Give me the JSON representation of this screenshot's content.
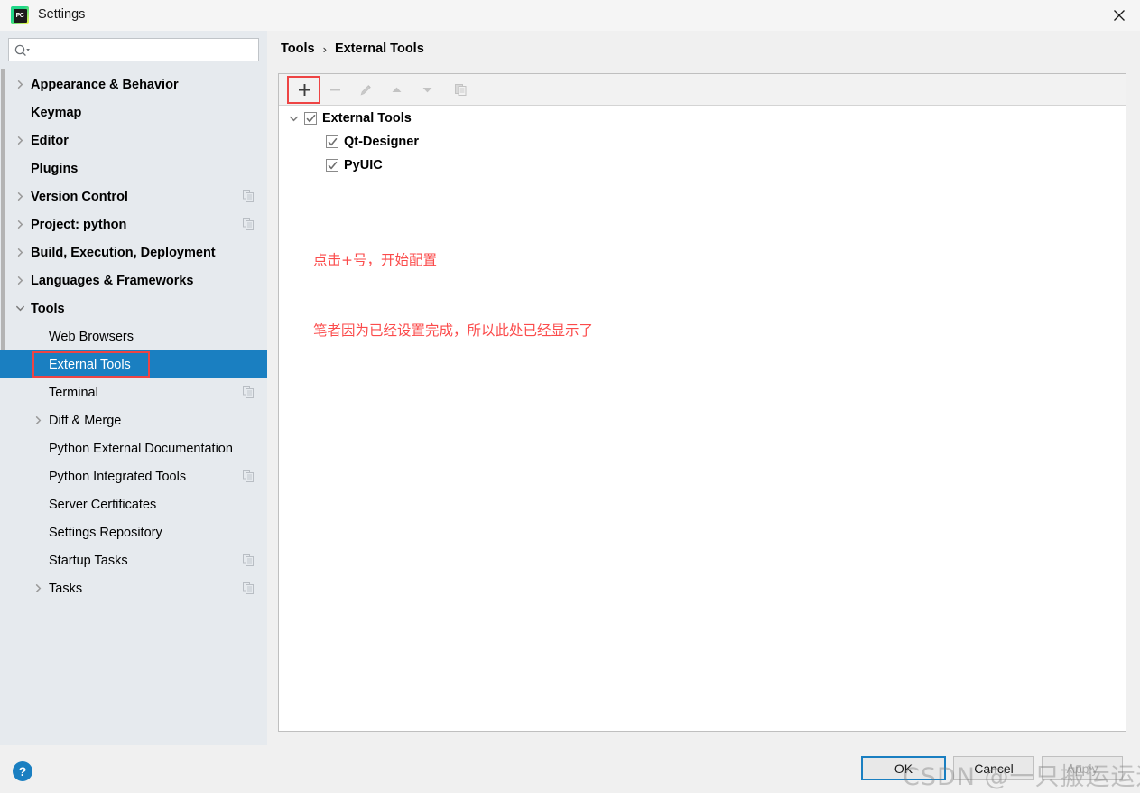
{
  "window": {
    "title": "Settings",
    "logo_text": "PC",
    "close_label": "✕"
  },
  "search": {
    "value": "",
    "placeholder": ""
  },
  "sidebar": {
    "items": [
      {
        "label": "Appearance & Behavior",
        "level": 1,
        "expandable": true,
        "expanded": false,
        "selected": false,
        "badge": false
      },
      {
        "label": "Keymap",
        "level": 1,
        "expandable": false,
        "expanded": false,
        "selected": false,
        "badge": false
      },
      {
        "label": "Editor",
        "level": 1,
        "expandable": true,
        "expanded": false,
        "selected": false,
        "badge": false
      },
      {
        "label": "Plugins",
        "level": 1,
        "expandable": false,
        "expanded": false,
        "selected": false,
        "badge": false
      },
      {
        "label": "Version Control",
        "level": 1,
        "expandable": true,
        "expanded": false,
        "selected": false,
        "badge": true
      },
      {
        "label": "Project: python",
        "level": 1,
        "expandable": true,
        "expanded": false,
        "selected": false,
        "badge": true
      },
      {
        "label": "Build, Execution, Deployment",
        "level": 1,
        "expandable": true,
        "expanded": false,
        "selected": false,
        "badge": false
      },
      {
        "label": "Languages & Frameworks",
        "level": 1,
        "expandable": true,
        "expanded": false,
        "selected": false,
        "badge": false
      },
      {
        "label": "Tools",
        "level": 1,
        "expandable": true,
        "expanded": true,
        "selected": false,
        "badge": false
      },
      {
        "label": "Web Browsers",
        "level": 2,
        "expandable": false,
        "expanded": false,
        "selected": false,
        "badge": false
      },
      {
        "label": "External Tools",
        "level": 2,
        "expandable": false,
        "expanded": false,
        "selected": true,
        "badge": false
      },
      {
        "label": "Terminal",
        "level": 2,
        "expandable": false,
        "expanded": false,
        "selected": false,
        "badge": true
      },
      {
        "label": "Diff & Merge",
        "level": 2,
        "expandable": true,
        "expanded": false,
        "selected": false,
        "badge": false
      },
      {
        "label": "Python External Documentation",
        "level": 2,
        "expandable": false,
        "expanded": false,
        "selected": false,
        "badge": false
      },
      {
        "label": "Python Integrated Tools",
        "level": 2,
        "expandable": false,
        "expanded": false,
        "selected": false,
        "badge": true
      },
      {
        "label": "Server Certificates",
        "level": 2,
        "expandable": false,
        "expanded": false,
        "selected": false,
        "badge": false
      },
      {
        "label": "Settings Repository",
        "level": 2,
        "expandable": false,
        "expanded": false,
        "selected": false,
        "badge": false
      },
      {
        "label": "Startup Tasks",
        "level": 2,
        "expandable": false,
        "expanded": false,
        "selected": false,
        "badge": true
      },
      {
        "label": "Tasks",
        "level": 2,
        "expandable": true,
        "expanded": false,
        "selected": false,
        "badge": true
      }
    ]
  },
  "breadcrumb": {
    "parent": "Tools",
    "separator": "›",
    "current": "External Tools"
  },
  "toolbar": {
    "buttons": [
      {
        "name": "add",
        "glyph": "+",
        "enabled": true,
        "highlighted": true
      },
      {
        "name": "remove",
        "glyph": "−",
        "enabled": false,
        "highlighted": false
      },
      {
        "name": "edit",
        "glyph": "pencil",
        "enabled": false,
        "highlighted": false
      },
      {
        "name": "move-up",
        "glyph": "▲",
        "enabled": false,
        "highlighted": false
      },
      {
        "name": "move-down",
        "glyph": "▼",
        "enabled": false,
        "highlighted": false
      },
      {
        "name": "copy",
        "glyph": "copy",
        "enabled": false,
        "highlighted": false
      }
    ]
  },
  "tool_tree": {
    "root": {
      "label": "External Tools",
      "checked": true,
      "expanded": true
    },
    "children": [
      {
        "label": "Qt-Designer",
        "checked": true
      },
      {
        "label": "PyUIC",
        "checked": true
      }
    ]
  },
  "annotation": {
    "line1": "点击+号，开始配置",
    "line2": "笔者因为已经设置完成，所以此处已经显示了",
    "color": "#fb4b4b"
  },
  "footer": {
    "help_label": "?",
    "ok_label": "OK",
    "cancel_label": "Cancel",
    "apply_label": "Apply"
  },
  "watermark": {
    "text": "CSDN @一只搬运运运运工"
  },
  "colors": {
    "selection": "#1a7fc1",
    "annotation_red": "#fb4b4b",
    "highlight_box": "#ee4444",
    "sidebar_bg": "#e6eaee",
    "panel_bg": "#ffffff"
  }
}
